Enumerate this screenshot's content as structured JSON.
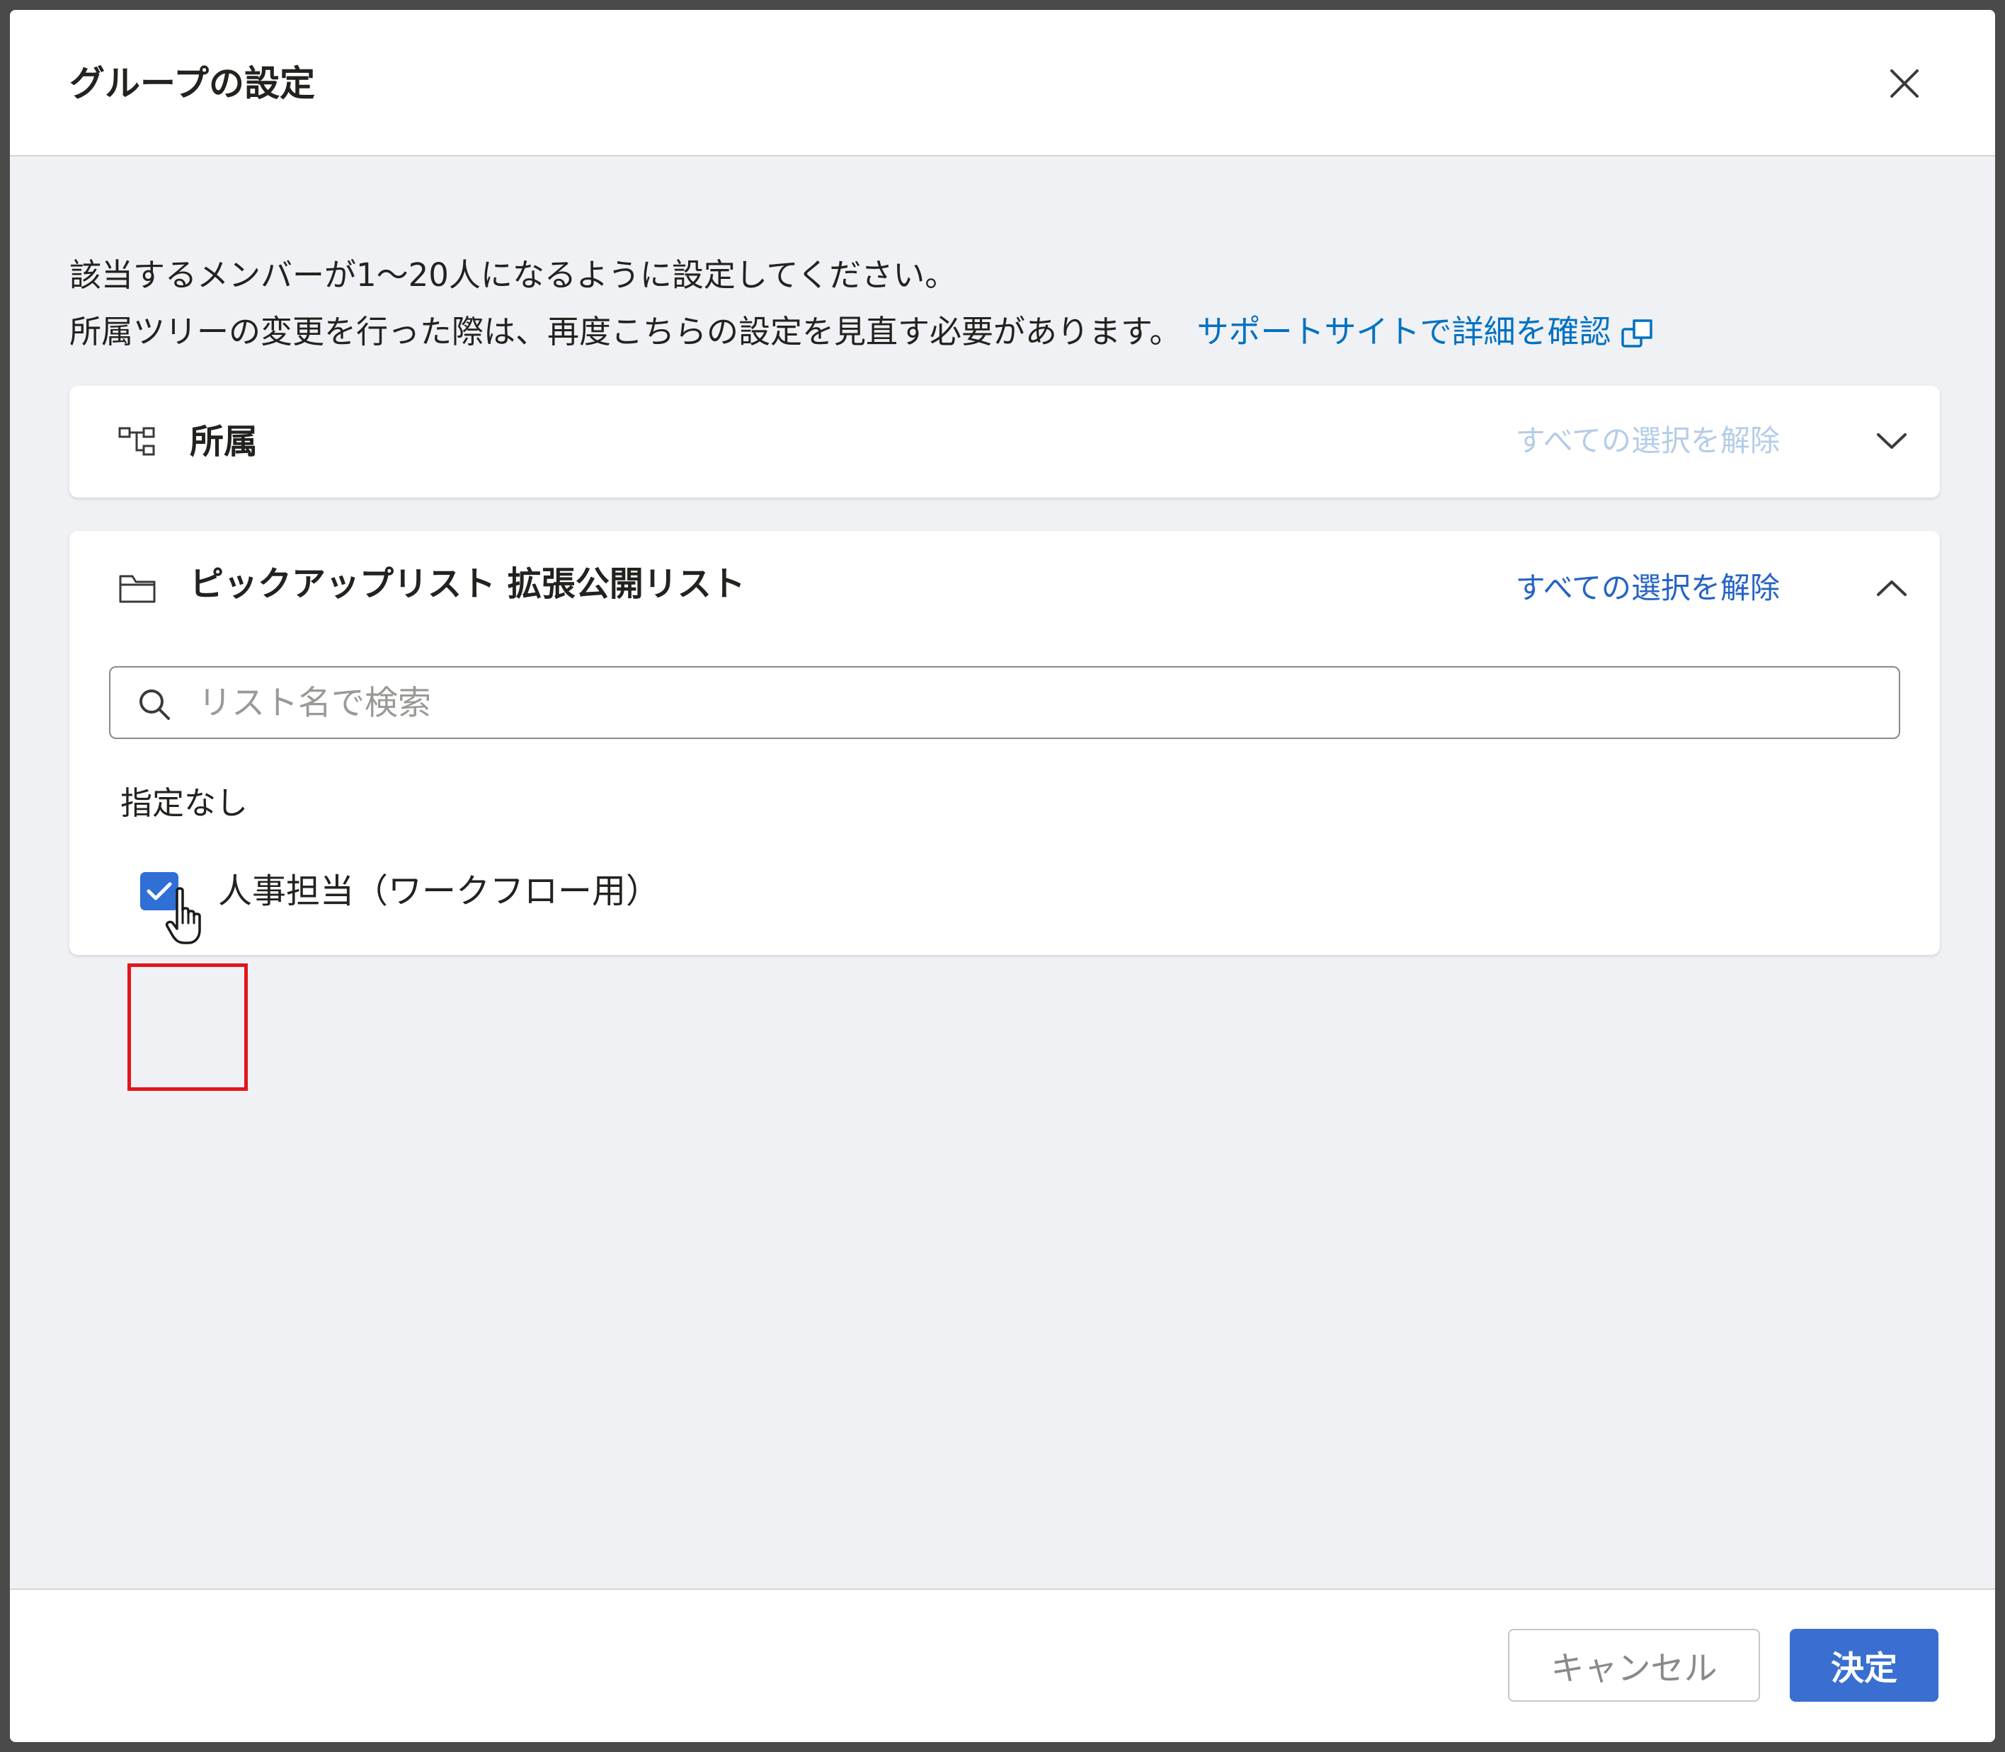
{
  "dialog": {
    "title": "グループの設定",
    "close_icon": "close-icon"
  },
  "description": {
    "line1": "該当するメンバーが1〜20人になるように設定してください。",
    "line2": "所属ツリーの変更を行った際は、再度こちらの設定を見直す必要があります。",
    "support_link": "サポートサイトで詳細を確認",
    "link_icon": "external-link-icon"
  },
  "affiliation_panel": {
    "icon": "org-tree-icon",
    "title": "所属",
    "clear_all": "すべての選択を解除",
    "expanded": false
  },
  "list_panel": {
    "icon": "folder-icon",
    "title": "ピックアップリスト 拡張公開リスト",
    "clear_all": "すべての選択を解除",
    "expanded": true,
    "search": {
      "placeholder": "リスト名で検索",
      "value": ""
    },
    "group_label": "指定なし",
    "items": [
      {
        "label": "人事担当（ワークフロー用）",
        "checked": true
      }
    ]
  },
  "footer": {
    "cancel_label": "キャンセル",
    "ok_label": "決定"
  },
  "colors": {
    "accent": "#3a6fd1",
    "link": "#0071c1",
    "highlight": "#e0161b",
    "background": "#eff1f5"
  }
}
